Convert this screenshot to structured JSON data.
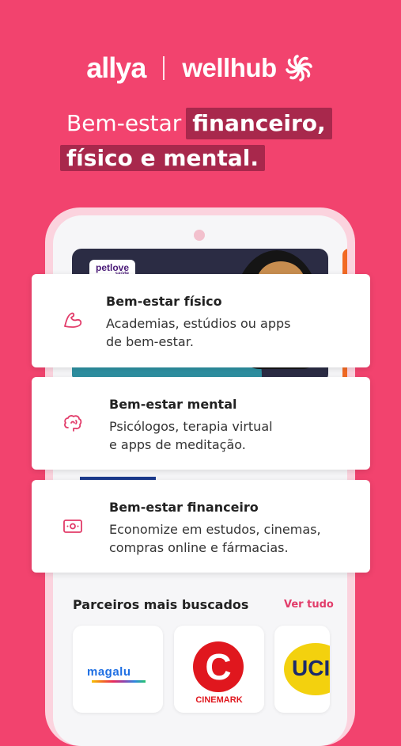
{
  "header": {
    "brand_left": "allya",
    "brand_right": "wellhub",
    "icon_brand": "wellhub-pinwheel-icon"
  },
  "headline": {
    "line1_plain": "Bem-estar",
    "line1_highlight": "financeiro,",
    "line2_highlight": "físico e mental."
  },
  "banner": {
    "brand": "petlove",
    "brand_sub": "saúde"
  },
  "features": [
    {
      "title": "Bem-estar físico",
      "description": "Academias, estúdios ou apps\nde bem-estar.",
      "icon": "flexed-arm-icon"
    },
    {
      "title": "Bem-estar mental",
      "description": "Psicólogos, terapia virtual\ne apps de meditação.",
      "icon": "brain-icon"
    },
    {
      "title": "Bem-estar financeiro",
      "description": "Economize em estudos, cinemas,\ncompras online e fármacias.",
      "icon": "money-bill-icon"
    }
  ],
  "partners": {
    "title": "Parceiros mais buscados",
    "see_all": "Ver tudo",
    "items": [
      {
        "name": "magalu"
      },
      {
        "name": "CINEMARK"
      },
      {
        "name": "UCI"
      }
    ]
  },
  "colors": {
    "background": "#F2436E",
    "highlight": "#A8284C",
    "accent": "#E23C6A"
  }
}
